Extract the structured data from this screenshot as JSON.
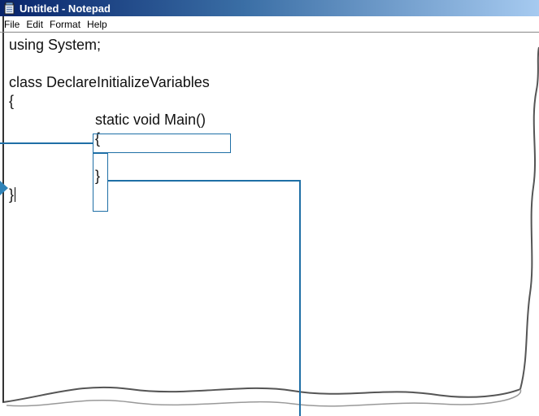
{
  "window": {
    "title": "Untitled - Notepad",
    "icon": "notepad-icon"
  },
  "menu": {
    "items": [
      "File",
      "Edit",
      "Format",
      "Help"
    ]
  },
  "editor": {
    "lines": [
      "using System;",
      "",
      "class DeclareInitializeVariables",
      "{",
      "static void Main()",
      "{",
      "",
      "}",
      "}"
    ]
  },
  "colors": {
    "callout": "#1f6fa6",
    "title_start": "#08246b",
    "title_end": "#a6caf0"
  }
}
